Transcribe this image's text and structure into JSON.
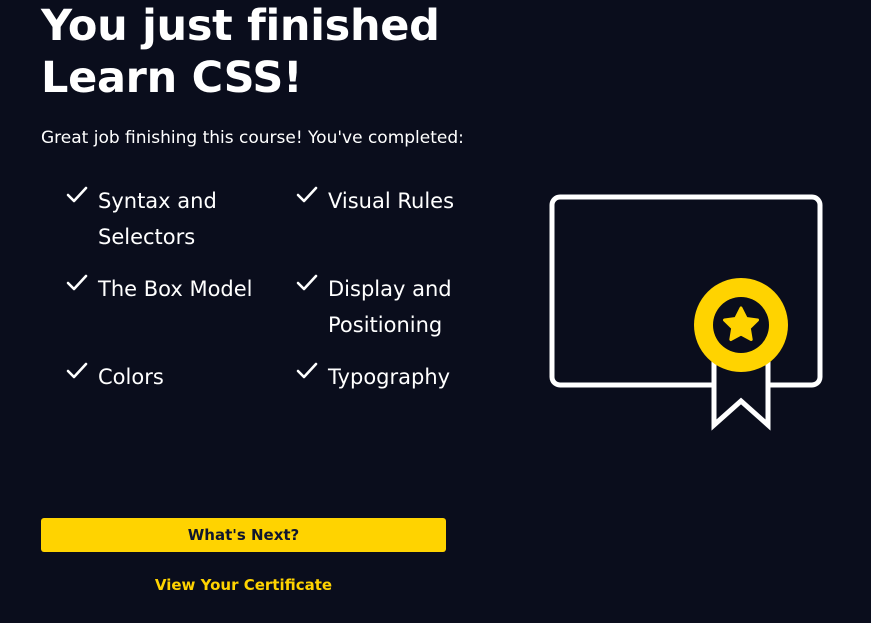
{
  "completion": {
    "heading_line1": "You just finished",
    "heading_line2": "Learn CSS!",
    "subtitle": "Great job finishing this course! You've completed:"
  },
  "modules": [
    {
      "label": "Syntax and Selectors",
      "icon": "checkmark-icon"
    },
    {
      "label": "Visual Rules",
      "icon": "checkmark-icon"
    },
    {
      "label": "The Box Model",
      "icon": "checkmark-icon"
    },
    {
      "label": "Display and Positioning",
      "icon": "checkmark-icon"
    },
    {
      "label": "Colors",
      "icon": "checkmark-icon"
    },
    {
      "label": "Typography",
      "icon": "checkmark-icon"
    }
  ],
  "actions": {
    "whats_next_label": "What's Next?",
    "view_certificate_label": "View Your Certificate"
  },
  "illustration": {
    "icon": "certificate-award-icon"
  },
  "colors": {
    "background": "#0a0d1c",
    "accent": "#ffd300",
    "text": "#ffffff",
    "button_text": "#10162f"
  }
}
